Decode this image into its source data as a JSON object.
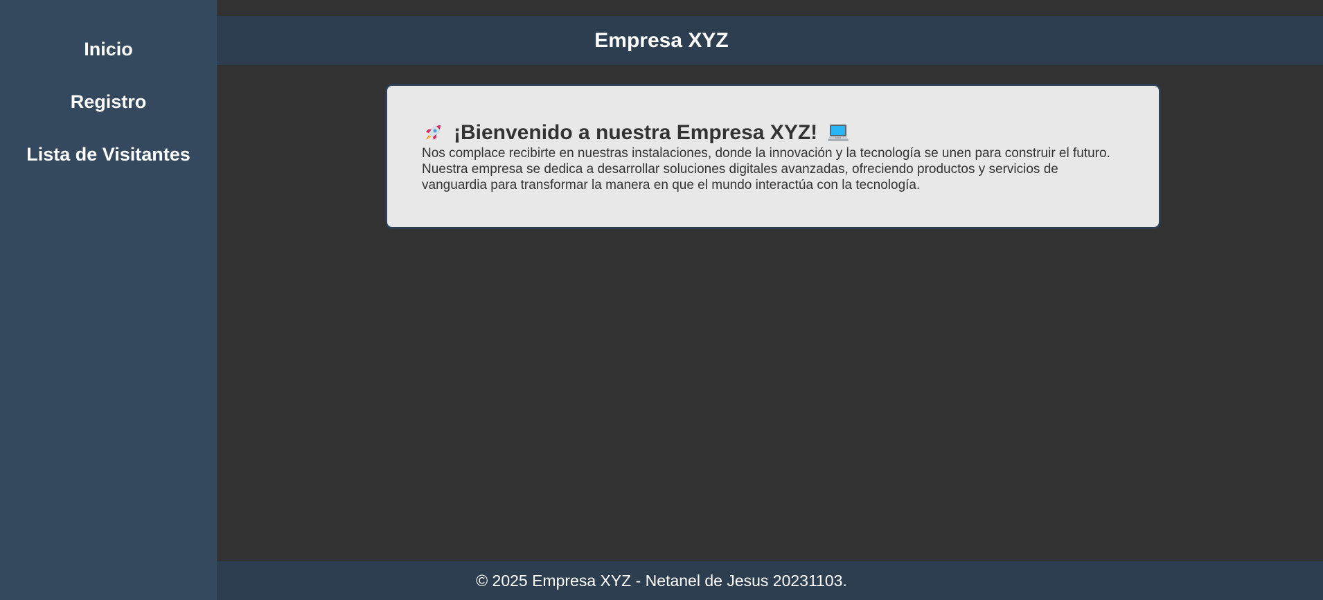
{
  "sidebar": {
    "items": [
      {
        "label": "Inicio"
      },
      {
        "label": "Registro"
      },
      {
        "label": "Lista de Visitantes"
      }
    ]
  },
  "header": {
    "title": "Empresa XYZ"
  },
  "welcome": {
    "heading": "¡Bienvenido a nuestra Empresa XYZ!",
    "leading_icon": "rocket-icon",
    "trailing_icon": "laptop-icon",
    "body": "Nos complace recibirte en nuestras instalaciones, donde la innovación y la tecnología se unen para construir el futuro. Nuestra empresa se dedica a desarrollar soluciones digitales avanzadas, ofreciendo productos y servicios de vanguardia para transformar la manera en que el mundo interactúa con la tecnología."
  },
  "footer": {
    "text": "© 2025 Empresa XYZ - Netanel de Jesus 20231103."
  },
  "colors": {
    "sidebar_bg": "#34495e",
    "header_bg": "#2c3e50",
    "page_bg": "#323232",
    "card_bg": "#e8e8e8",
    "text_dark": "#333333",
    "text_light": "#ffffff"
  }
}
